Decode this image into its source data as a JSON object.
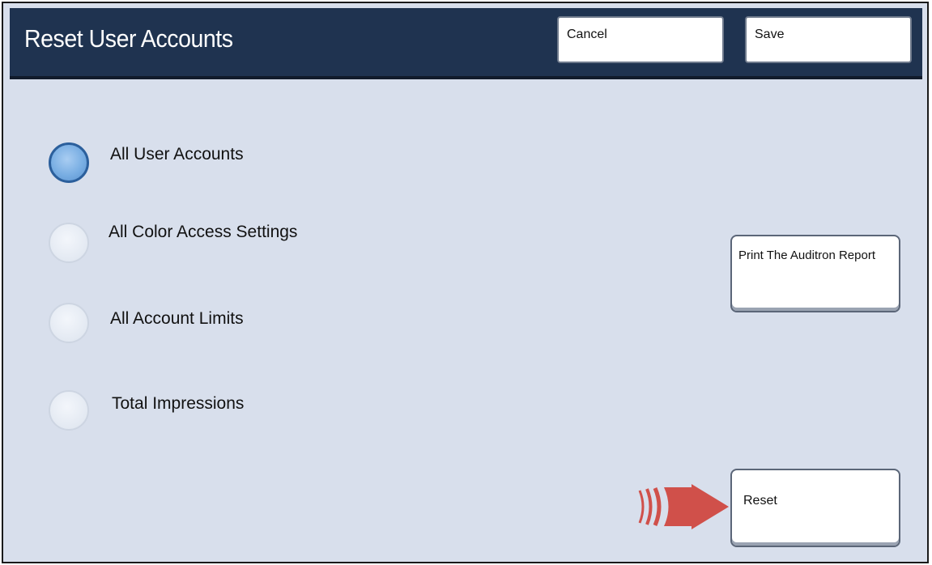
{
  "header": {
    "title": "Reset User Accounts",
    "cancel_label": "Cancel",
    "save_label": "Save"
  },
  "options": [
    {
      "label": "All User Accounts",
      "selected": true
    },
    {
      "label": "All Color Access Settings",
      "selected": false
    },
    {
      "label": "All Account Limits",
      "selected": false
    },
    {
      "label": "Total Impressions",
      "selected": false
    }
  ],
  "actions": {
    "print_report_label": "Print The Auditron Report",
    "reset_label": "Reset"
  },
  "colors": {
    "header_bg": "#1f3350",
    "panel_bg": "#d8dfec",
    "radio_selected": "#79aee3",
    "arrow": "#d0504a"
  },
  "icons": {
    "pointer": "arrow-right-icon"
  }
}
